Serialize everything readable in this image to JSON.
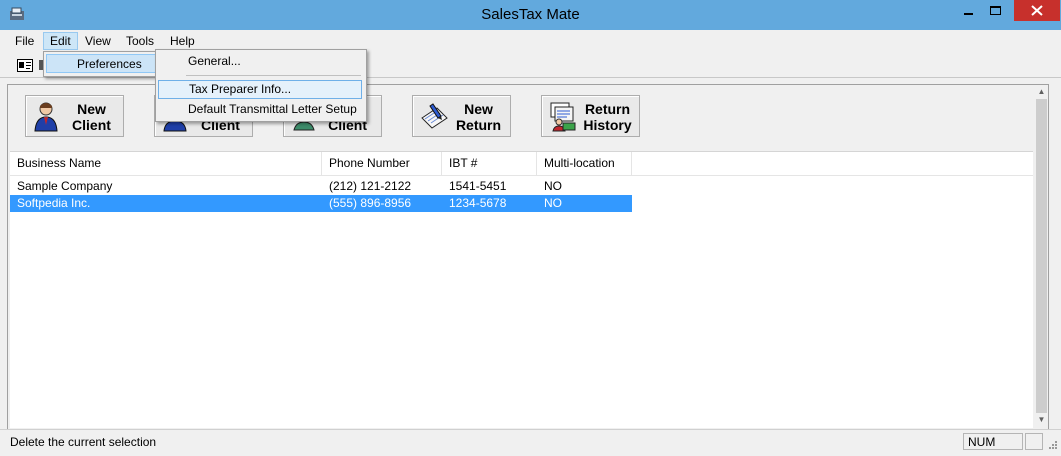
{
  "window": {
    "title": "SalesTax Mate"
  },
  "menubar": {
    "items": [
      "File",
      "Edit",
      "View",
      "Tools",
      "Help"
    ]
  },
  "edit_menu": {
    "items": [
      "Preferences"
    ]
  },
  "preferences_submenu": {
    "items": [
      "General...",
      "Tax Preparer Info...",
      "Default Transmittal Letter Setup"
    ]
  },
  "actions": [
    {
      "line1": "New",
      "line2": "Client",
      "icon": "person-icon"
    },
    {
      "line1": "",
      "line2": "Client",
      "icon": "person-icon"
    },
    {
      "line1": "e",
      "line2": "Client",
      "icon": "delete-client-icon"
    },
    {
      "line1": "New",
      "line2": "Return",
      "icon": "new-return-icon"
    },
    {
      "line1": "Return",
      "line2": "History",
      "icon": "return-history-icon"
    }
  ],
  "list": {
    "columns": [
      "Business Name",
      "Phone Number",
      "IBT #",
      "Multi-location"
    ],
    "rows": [
      {
        "name": "Sample Company",
        "phone": "(212) 121-2122",
        "ibt": "1541-5451",
        "multi": "NO",
        "selected": false
      },
      {
        "name": "Softpedia Inc.",
        "phone": "(555) 896-8956",
        "ibt": "1234-5678",
        "multi": "NO",
        "selected": true
      }
    ]
  },
  "statusbar": {
    "message": "Delete the current selection",
    "num": "NUM"
  },
  "colors": {
    "titlebar": "#62a9dd",
    "close": "#c7302c",
    "selection": "#3399ff"
  }
}
